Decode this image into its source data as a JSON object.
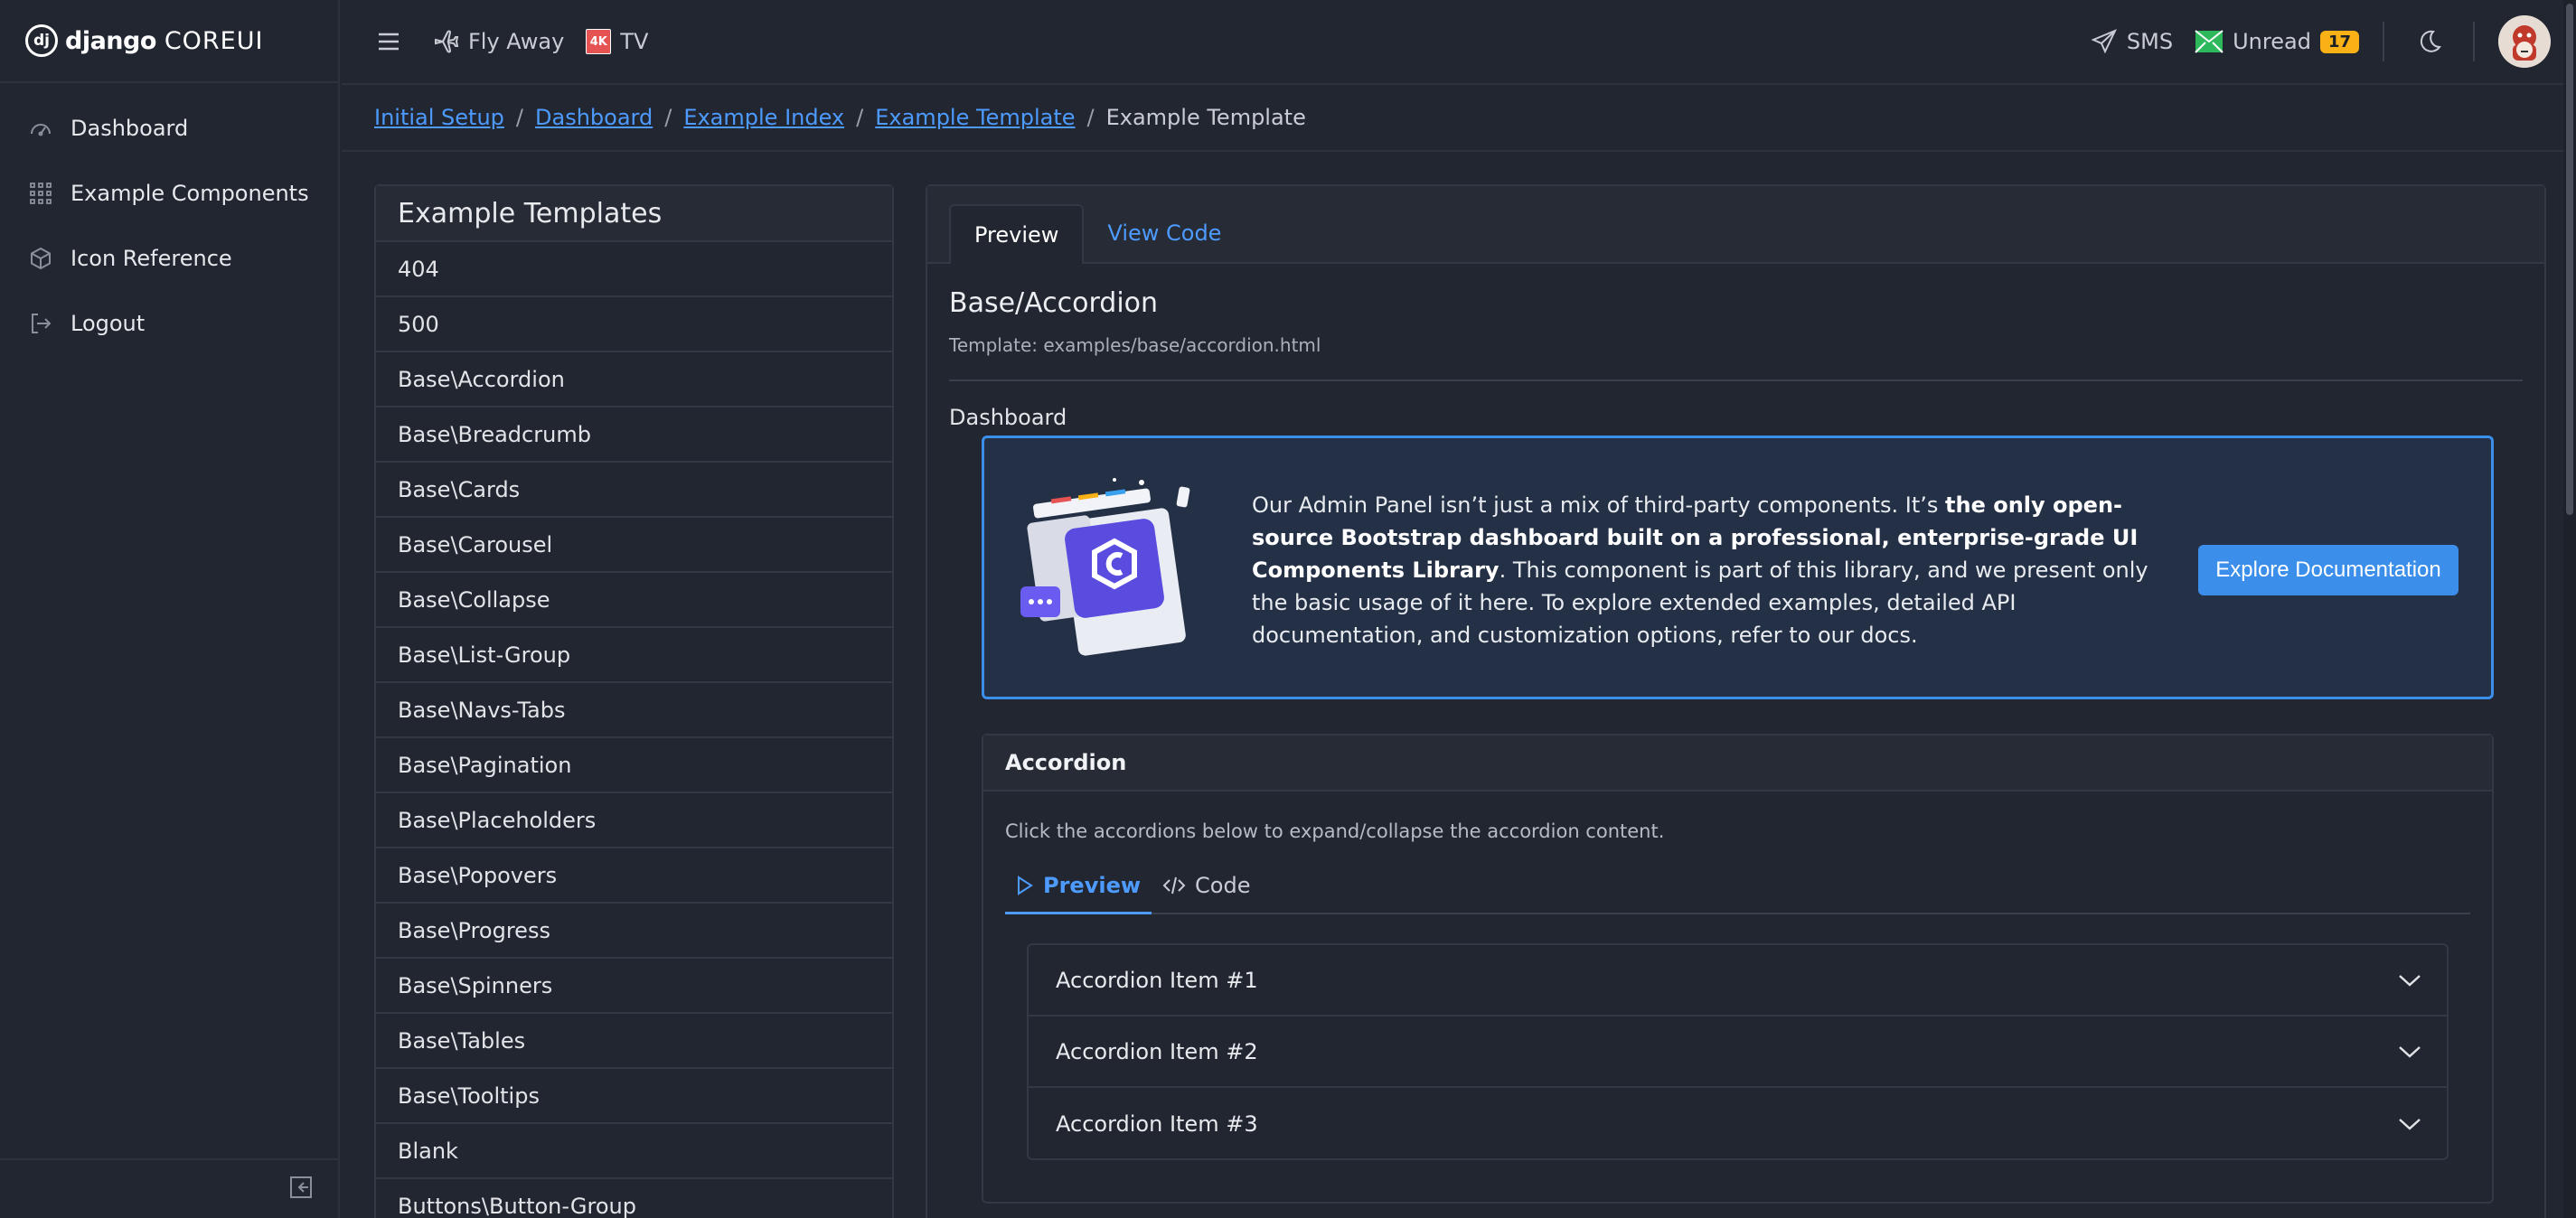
{
  "brand": {
    "name_bold": "django",
    "name_light": "COREUI",
    "logo_glyph": "dj"
  },
  "sidebar": {
    "items": [
      {
        "label": "Dashboard",
        "icon": "speedometer-icon"
      },
      {
        "label": "Example Components",
        "icon": "grid-dots-icon"
      },
      {
        "label": "Icon Reference",
        "icon": "cube-icon"
      },
      {
        "label": "Logout",
        "icon": "logout-icon"
      }
    ]
  },
  "header": {
    "links": [
      {
        "label": "Fly Away",
        "icon": "airplane-icon"
      },
      {
        "label": "TV",
        "icon": "4k-icon",
        "icon_text": "4K"
      }
    ],
    "sms_label": "SMS",
    "unread_label": "Unread",
    "unread_count": "17"
  },
  "breadcrumb": {
    "links": [
      "Initial Setup",
      "Dashboard",
      "Example Index",
      "Example Template"
    ],
    "separator": "/",
    "current": "Example Template"
  },
  "templates_list": {
    "title": "Example Templates",
    "items": [
      "404",
      "500",
      "Base\\Accordion",
      "Base\\Breadcrumb",
      "Base\\Cards",
      "Base\\Carousel",
      "Base\\Collapse",
      "Base\\List-Group",
      "Base\\Navs-Tabs",
      "Base\\Pagination",
      "Base\\Placeholders",
      "Base\\Popovers",
      "Base\\Progress",
      "Base\\Spinners",
      "Base\\Tables",
      "Base\\Tooltips",
      "Blank",
      "Buttons\\Button-Group"
    ]
  },
  "main": {
    "tabs": [
      "Preview",
      "View Code"
    ],
    "title": "Base/Accordion",
    "template_path": "Template: examples/base/accordion.html",
    "dashboard_label": "Dashboard",
    "promo": {
      "text_before": "Our Admin Panel isn’t just a mix of third-party components. It’s ",
      "text_bold": "the only open-source Bootstrap dashboard built on a professional, enterprise-grade UI Components Library",
      "text_after": ". This component is part of this library, and we present only the basic usage of it here. To explore extended examples, detailed API documentation, and customization options, refer to our docs.",
      "button": "Explore Documentation"
    },
    "accordion_card": {
      "title": "Accordion",
      "description": "Click the accordions below to expand/collapse the accordion content.",
      "tabs": [
        "Preview",
        "Code"
      ],
      "items": [
        "Accordion Item #1",
        "Accordion Item #2",
        "Accordion Item #3"
      ]
    }
  },
  "colors": {
    "accent": "#3b8eea",
    "link": "#4d9bff",
    "badge": "#f9b115",
    "background": "#212631"
  }
}
